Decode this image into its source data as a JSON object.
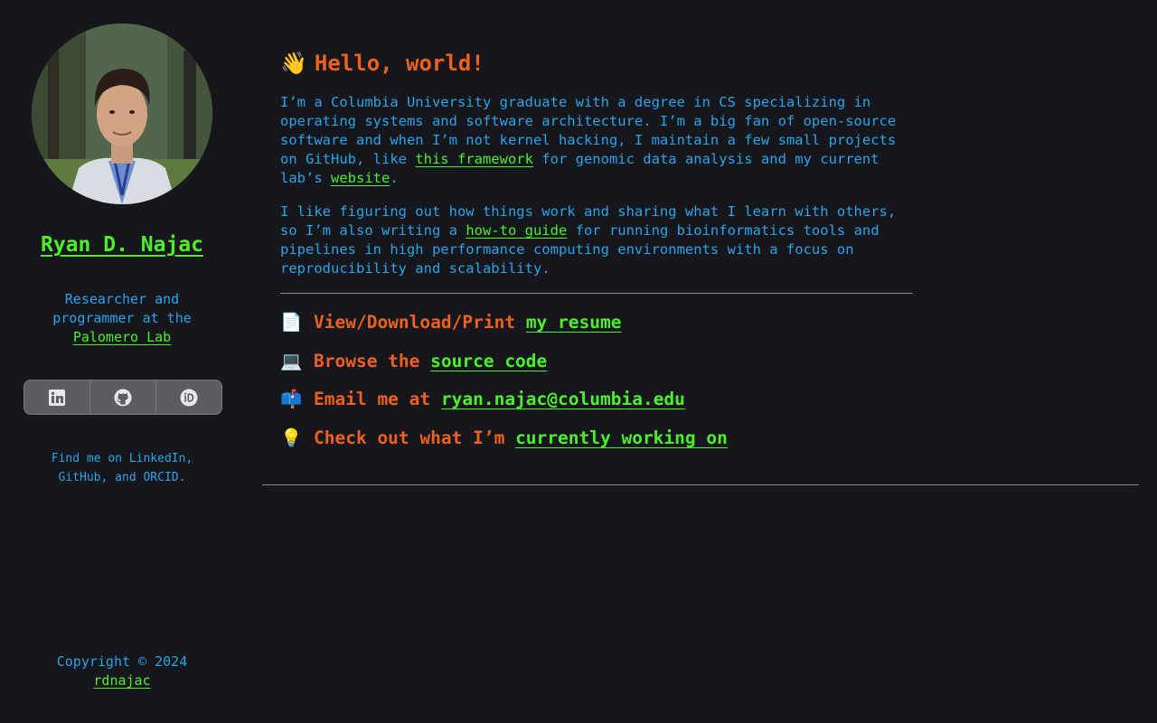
{
  "sidebar": {
    "name": "Ryan D. Najac",
    "tagline_prefix": "Researcher and programmer at the",
    "lab_link": "Palomero Lab",
    "social": [
      {
        "name": "linkedin-icon"
      },
      {
        "name": "github-icon"
      },
      {
        "name": "orcid-icon"
      }
    ],
    "findme": "Find me on LinkedIn, GitHub, and ORCID.",
    "copyright": "Copyright © 2024",
    "copyright_link": "rdnajac"
  },
  "main": {
    "hello_emoji": "👋",
    "hello": "Hello, world!",
    "p1": {
      "t1": "I’m a Columbia University graduate with a degree in CS specializing in operating systems and software architecture. I’m a big fan of open-source software and when I’m not kernel hacking, I maintain a few small projects on GitHub, like ",
      "link1": "this framework",
      "t2": " for genomic data analysis and my current lab’s ",
      "link2": "website",
      "t3": "."
    },
    "p2": {
      "t1": "I like figuring out how things work and sharing what I learn with others, so I’m also writing a ",
      "link1": "how-to guide",
      "t2": " for running bioinformatics tools and pipelines in high performance computing environments with a focus on reproducibility and scalability."
    },
    "actions": [
      {
        "emoji": "📄",
        "text": "View/Download/Print ",
        "link": "my resume"
      },
      {
        "emoji": "💻",
        "text": "Browse the ",
        "link": "source code"
      },
      {
        "emoji": "📫",
        "text": "Email me at ",
        "link": "ryan.najac@columbia.edu"
      },
      {
        "emoji": "💡",
        "text": "Check out what I’m ",
        "link": "currently working on"
      }
    ]
  },
  "colors": {
    "background": "#15171c",
    "accent_orange": "#f0601e",
    "link_green": "#4cf02a",
    "text_blue": "#2aa4e8"
  }
}
